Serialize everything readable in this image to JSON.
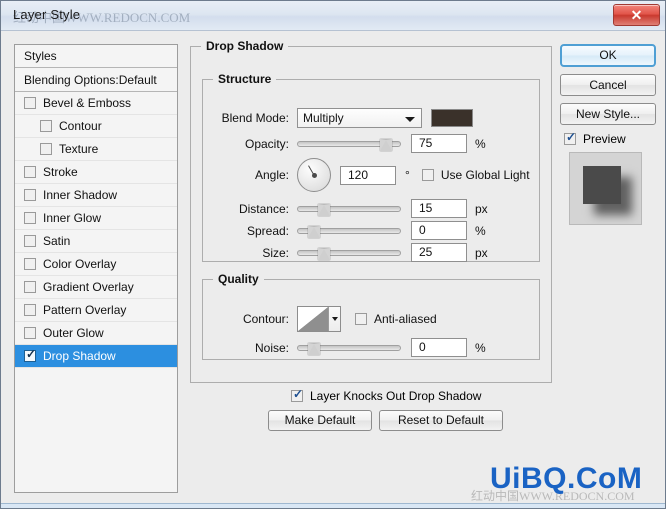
{
  "window": {
    "title": "Layer Style",
    "title_watermark": "红动中国WWW.REDOCN.COM",
    "close_label": "✕"
  },
  "styles_panel": {
    "header": "Styles",
    "blending_options": "Blending Options:Default",
    "items": [
      {
        "label": "Bevel & Emboss",
        "checked": false,
        "indent": false,
        "selected": false
      },
      {
        "label": "Contour",
        "checked": false,
        "indent": true,
        "selected": false
      },
      {
        "label": "Texture",
        "checked": false,
        "indent": true,
        "selected": false
      },
      {
        "label": "Stroke",
        "checked": false,
        "indent": false,
        "selected": false
      },
      {
        "label": "Inner Shadow",
        "checked": false,
        "indent": false,
        "selected": false
      },
      {
        "label": "Inner Glow",
        "checked": false,
        "indent": false,
        "selected": false
      },
      {
        "label": "Satin",
        "checked": false,
        "indent": false,
        "selected": false
      },
      {
        "label": "Color Overlay",
        "checked": false,
        "indent": false,
        "selected": false
      },
      {
        "label": "Gradient Overlay",
        "checked": false,
        "indent": false,
        "selected": false
      },
      {
        "label": "Pattern Overlay",
        "checked": false,
        "indent": false,
        "selected": false
      },
      {
        "label": "Outer Glow",
        "checked": false,
        "indent": false,
        "selected": false
      },
      {
        "label": "Drop Shadow",
        "checked": true,
        "indent": false,
        "selected": true
      }
    ]
  },
  "drop_shadow": {
    "group_title": "Drop Shadow",
    "structure": {
      "group_title": "Structure",
      "blend_mode_label": "Blend Mode:",
      "blend_mode_value": "Multiply",
      "shadow_color": "#3a312a",
      "opacity_label": "Opacity:",
      "opacity_value": "75",
      "opacity_unit": "%",
      "opacity_percent": 75,
      "angle_label": "Angle:",
      "angle_value": "120",
      "angle_degree_symbol": "°",
      "use_global_light_label": "Use Global Light",
      "use_global_light_checked": false,
      "distance_label": "Distance:",
      "distance_value": "15",
      "distance_unit": "px",
      "distance_percent": 12,
      "spread_label": "Spread:",
      "spread_value": "0",
      "spread_unit": "%",
      "spread_percent": 2,
      "size_label": "Size:",
      "size_value": "25",
      "size_unit": "px",
      "size_percent": 12
    },
    "quality": {
      "group_title": "Quality",
      "contour_label": "Contour:",
      "anti_aliased_label": "Anti-aliased",
      "anti_aliased_checked": false,
      "noise_label": "Noise:",
      "noise_value": "0",
      "noise_unit": "%",
      "noise_percent": 2
    },
    "knocks_out_label": "Layer Knocks Out Drop Shadow",
    "knocks_out_checked": true,
    "make_default_label": "Make Default",
    "reset_default_label": "Reset to Default"
  },
  "actions": {
    "ok_label": "OK",
    "cancel_label": "Cancel",
    "new_style_label": "New Style...",
    "preview_label": "Preview",
    "preview_checked": true
  },
  "watermarks": {
    "big": "UiBQ.CoM",
    "small": "红动中国WWW.REDOCN.COM"
  }
}
